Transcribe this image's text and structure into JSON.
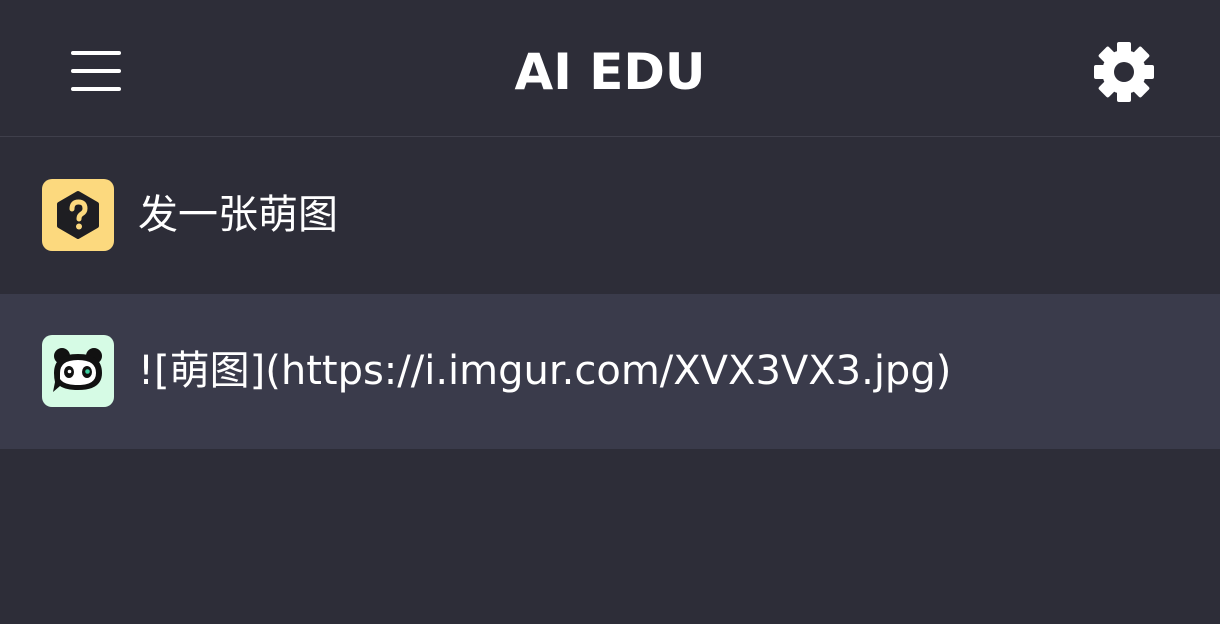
{
  "header": {
    "title": "AI EDU",
    "menu_icon": "hamburger-menu-icon",
    "settings_icon": "gear-icon"
  },
  "messages": [
    {
      "role": "user",
      "avatar_icon": "question-hexagon-icon",
      "text": "发一张萌图"
    },
    {
      "role": "assistant",
      "avatar_icon": "panda-bot-icon",
      "text": "![萌图](https://i.imgur.com/XVX3VX3.jpg)"
    }
  ],
  "colors": {
    "background": "#2d2d38",
    "response_row": "#3a3b4b",
    "user_avatar_bg": "#fcd97e",
    "bot_avatar_bg": "#d6fbe5",
    "text": "#ffffff"
  }
}
